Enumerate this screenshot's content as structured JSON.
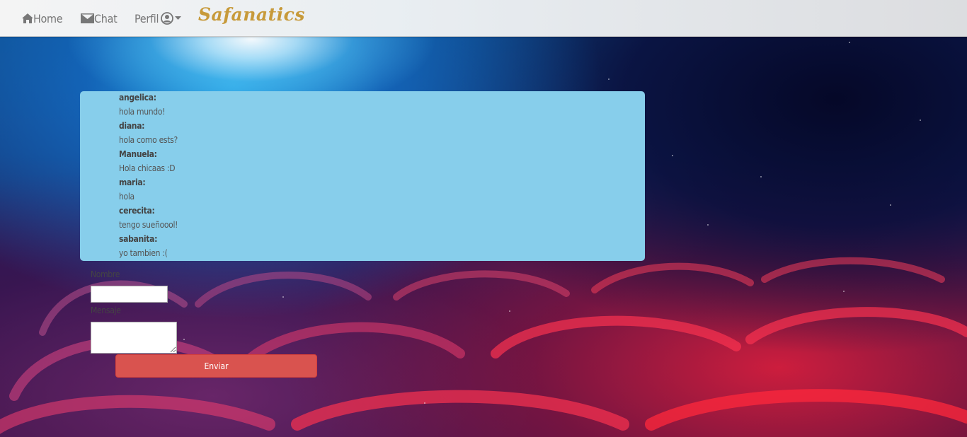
{
  "navbar": {
    "home_label": "Home",
    "chat_label": "Chat",
    "profile_label": "Perfil",
    "brand": "Safanatics"
  },
  "chat": {
    "messages": [
      {
        "user": "angelica:",
        "text": "hola mundo!"
      },
      {
        "user": "diana:",
        "text": "hola como ests?"
      },
      {
        "user": "Manuela:",
        "text": "Hola chicaas :D"
      },
      {
        "user": "maria:",
        "text": "hola"
      },
      {
        "user": "cerecita:",
        "text": "tengo sueñoool!"
      },
      {
        "user": "sabanita:",
        "text": "yo tambien :("
      }
    ]
  },
  "form": {
    "name_label": "Nombre",
    "name_value": "",
    "message_label": "Mensaje",
    "message_value": "",
    "send_label": "Enviar"
  },
  "colors": {
    "chat_bg": "#87ceeb",
    "send_button": "#d9534f",
    "brand": "#c79a3a"
  }
}
